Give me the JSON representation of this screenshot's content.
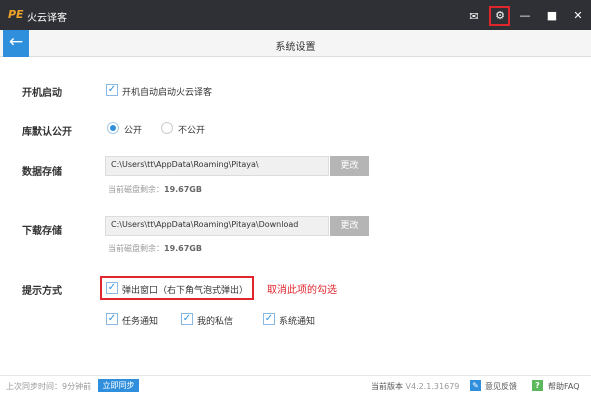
{
  "titlebar": {
    "logo": "PE",
    "app_title": "火云译客",
    "icons": [
      "mail-icon",
      "gear-icon",
      "minimize-icon",
      "maximize-icon",
      "close-icon"
    ],
    "mail_glyph": "✉",
    "gear_glyph": "⚙",
    "min_glyph": "—",
    "max_glyph": "■",
    "close_glyph": "✕"
  },
  "header": {
    "back_glyph": "←",
    "title": "系统设置"
  },
  "startup": {
    "label": "开机启动",
    "option": {
      "label": "开机自动启动火云译客",
      "checked": true
    }
  },
  "public_default": {
    "label": "库默认公开",
    "options": [
      {
        "label": "公开",
        "selected": true
      },
      {
        "label": "不公开",
        "selected": false
      }
    ]
  },
  "data_storage": {
    "label": "数据存储",
    "path": "C:\\Users\\tt\\AppData\\Roaming\\Pitaya\\",
    "change_label": "更改",
    "space_prefix": "当前磁盘剩余：",
    "space_value": "19.67GB"
  },
  "download_storage": {
    "label": "下载存储",
    "path": "C:\\Users\\tt\\AppData\\Roaming\\Pitaya\\Download",
    "change_label": "更改",
    "space_prefix": "当前磁盘剩余：",
    "space_value": "19.67GB"
  },
  "notify": {
    "label": "提示方式",
    "popup": {
      "label": "弹出窗口（右下角气泡式弹出）",
      "checked": true
    },
    "annotation": "取消此项的勾选",
    "options": [
      {
        "label": "任务通知",
        "checked": true
      },
      {
        "label": "我的私信",
        "checked": true
      },
      {
        "label": "系统通知",
        "checked": true
      }
    ]
  },
  "footer": {
    "sync_text": "上次同步时间：9分钟前",
    "sync_button": "立即同步",
    "version_label": "当前版本",
    "version_number": "V4.2.1.31679",
    "feedback_label": "意见反馈",
    "feedback_glyph": "✎",
    "help_label": "帮助FAQ",
    "help_glyph": "?"
  },
  "colors": {
    "accent": "#2f8fdd",
    "titlebar": "#2f3035",
    "highlight_red": "#e0262d"
  }
}
